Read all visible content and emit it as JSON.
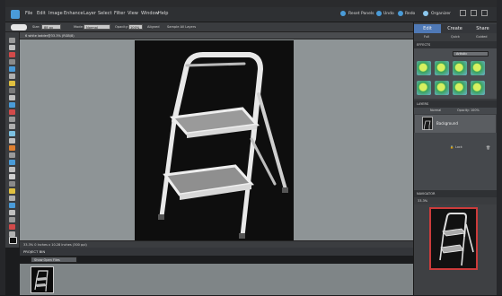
{
  "menubar": {
    "items": [
      "File",
      "Edit",
      "Image",
      "Enhance",
      "Layer",
      "Select",
      "Filter",
      "View",
      "Window",
      "Help"
    ],
    "right": {
      "reset_panels": "Reset Panels",
      "undo": "Undo",
      "redo": "Redo",
      "organizer": "Organizer"
    }
  },
  "options": {
    "size_label": "Size:",
    "size_value": "88 px",
    "mode_label": "Mode:",
    "mode_value": "Normal",
    "opacity_label": "Opacity:",
    "opacity_value": "100%",
    "aligned": "Aligned",
    "sample": "Sample All Layers"
  },
  "document": {
    "tab": "6 white ladder@33.3% (RGB/8)",
    "status": "33.3%   0 Inches x 10.28 Inches (300 ppi)"
  },
  "project_bin": {
    "title": "PROJECT BIN",
    "select": "Show Open Files"
  },
  "panels": {
    "tabs": [
      "Edit",
      "Create",
      "Share"
    ],
    "subtabs": [
      "Full",
      "Quick",
      "Guided"
    ],
    "effects_title": "EFFECTS",
    "effects_filter": "Artistic",
    "layers_title": "LAYERS",
    "layers_mode": "Normal",
    "layers_opacity": "Opacity: 100%",
    "layer_name": "Background",
    "lock_label": "Lock",
    "navigator_title": "NAVIGATOR",
    "zoom": "33.3%"
  },
  "colors": {
    "accent": "#4a9bd8",
    "tab_active": "#4f79b6",
    "nav_frame": "#cc3b3b"
  },
  "icons": [
    "photoshop-elements-logo",
    "reset-panels-icon",
    "undo-icon",
    "redo-icon",
    "organizer-icon",
    "clone-stamp-icon",
    "lock-icon",
    "trash-icon"
  ]
}
